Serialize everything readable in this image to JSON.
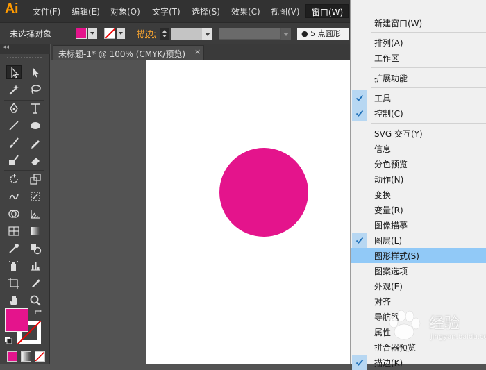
{
  "app": {
    "logo": "Ai"
  },
  "menubar": {
    "items": [
      "文件(F)",
      "编辑(E)",
      "对象(O)",
      "文字(T)",
      "选择(S)",
      "效果(C)",
      "视图(V)"
    ],
    "window_menu": "窗口(W)"
  },
  "control_bar": {
    "selection_status": "未选择对象",
    "stroke_label": "描边:",
    "brush_field": "●  5 点圆形",
    "fill_color": "#e4148c"
  },
  "document_tab": {
    "title": "未标题-1* @ 100% (CMYK/预览)",
    "close": "×"
  },
  "tools": {
    "collapse_glyph": "◂◂",
    "list": [
      "selection-tool",
      "direct-selection-tool",
      "magic-wand-tool",
      "lasso-tool",
      "pen-tool",
      "type-tool",
      "line-tool",
      "ellipse-tool",
      "paintbrush-tool",
      "pencil-tool",
      "blob-brush-tool",
      "eraser-tool",
      "rotate-tool",
      "scale-tool",
      "warp-tool",
      "free-transform-tool",
      "shape-builder-tool",
      "perspective-grid-tool",
      "mesh-tool",
      "gradient-tool",
      "eyedropper-tool",
      "blend-tool",
      "symbol-sprayer-tool",
      "column-graph-tool",
      "artboard-tool",
      "slice-tool",
      "hand-tool",
      "zoom-tool"
    ]
  },
  "canvas": {
    "artboard_color": "#ffffff",
    "circle_color": "#e4148c"
  },
  "window_menu": {
    "items": [
      {
        "label": "新建窗口(W)",
        "checked": false,
        "highlighted": false
      },
      {
        "label": "排列(A)",
        "checked": false,
        "highlighted": false
      },
      {
        "label": "工作区",
        "checked": false,
        "highlighted": false
      },
      {
        "label": "扩展功能",
        "checked": false,
        "highlighted": false
      },
      {
        "label": "工具",
        "checked": true,
        "highlighted": false
      },
      {
        "label": "控制(C)",
        "checked": true,
        "highlighted": false
      },
      {
        "label": "SVG 交互(Y)",
        "checked": false,
        "highlighted": false
      },
      {
        "label": "信息",
        "checked": false,
        "highlighted": false
      },
      {
        "label": "分色预览",
        "checked": false,
        "highlighted": false
      },
      {
        "label": "动作(N)",
        "checked": false,
        "highlighted": false
      },
      {
        "label": "变换",
        "checked": false,
        "highlighted": false
      },
      {
        "label": "变量(R)",
        "checked": false,
        "highlighted": false
      },
      {
        "label": "图像描摹",
        "checked": false,
        "highlighted": false
      },
      {
        "label": "图层(L)",
        "checked": true,
        "highlighted": false
      },
      {
        "label": "图形样式(S)",
        "checked": false,
        "highlighted": true
      },
      {
        "label": "图案选项",
        "checked": false,
        "highlighted": false
      },
      {
        "label": "外观(E)",
        "checked": false,
        "highlighted": false
      },
      {
        "label": "对齐",
        "checked": false,
        "highlighted": false
      },
      {
        "label": "导航器",
        "checked": false,
        "highlighted": false
      },
      {
        "label": "属性",
        "checked": false,
        "highlighted": false
      },
      {
        "label": "拼合器预览",
        "checked": false,
        "highlighted": false
      },
      {
        "label": "描边(K)",
        "checked": true,
        "highlighted": false
      }
    ]
  },
  "watermark": {
    "text": "经验",
    "sub": "jingyan.baidu.com"
  }
}
